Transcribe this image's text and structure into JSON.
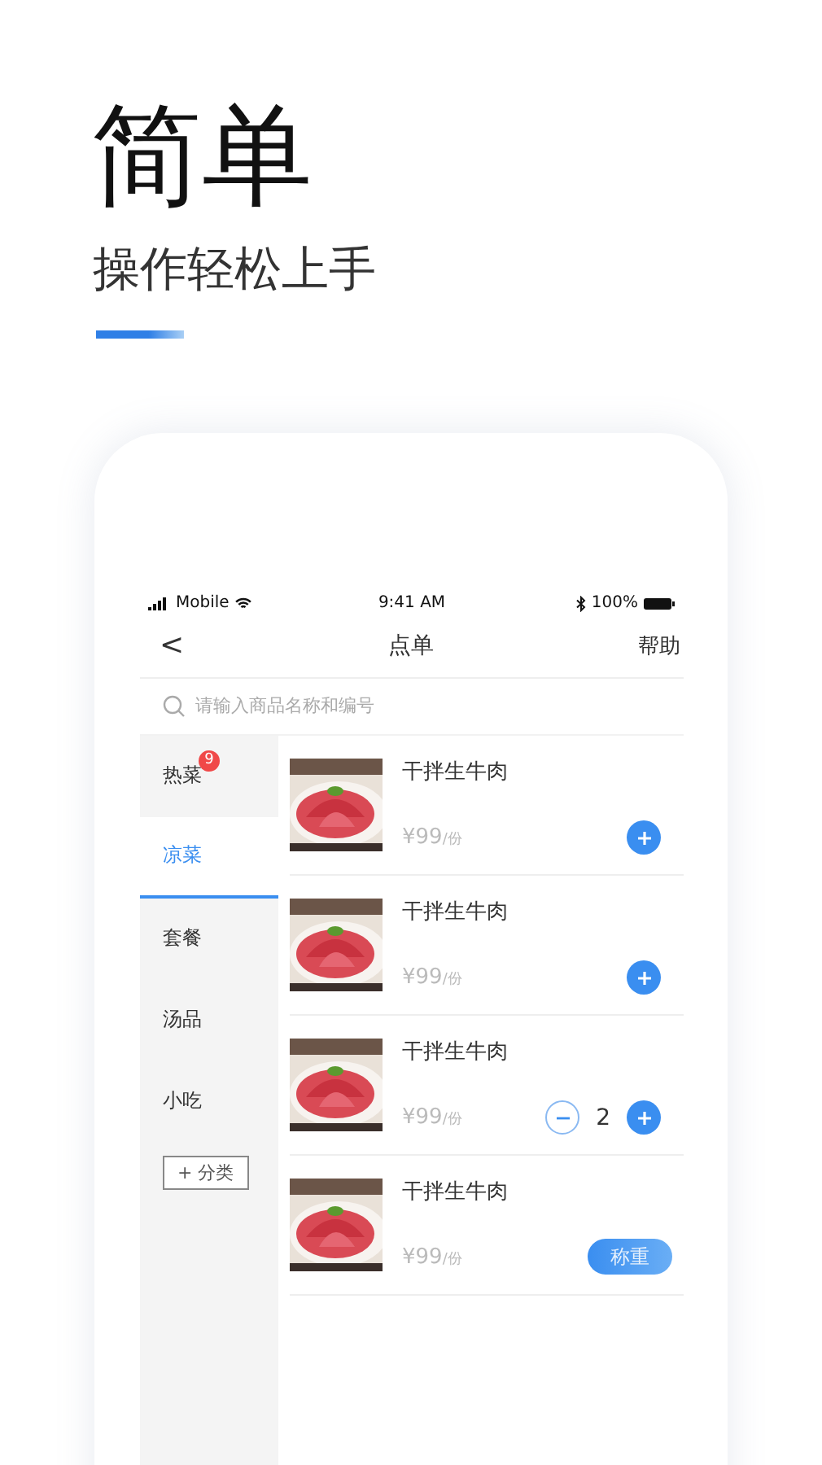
{
  "headline": "简单",
  "subtitle": "操作轻松上手",
  "status_bar": {
    "carrier": "Mobile",
    "time": "9:41 AM",
    "battery": "100%"
  },
  "nav": {
    "back": "<",
    "title": "点单",
    "action": "帮助"
  },
  "search": {
    "placeholder": "请输入商品名称和编号"
  },
  "categories": [
    {
      "label": "热菜",
      "selected": false,
      "badge": "9"
    },
    {
      "label": "凉菜",
      "selected": true
    },
    {
      "label": "套餐",
      "selected": false
    },
    {
      "label": "汤品",
      "selected": false
    },
    {
      "label": "小吃",
      "selected": false
    }
  ],
  "add_category": "+ 分类",
  "dishes": [
    {
      "kind": "add",
      "name": "干拌生牛肉",
      "price": "¥99",
      "unit": "/份"
    },
    {
      "kind": "add",
      "name": "干拌生牛肉",
      "price": "¥99",
      "unit": "/份"
    },
    {
      "kind": "stepper",
      "name": "干拌生牛肉",
      "price": "¥99",
      "unit": "/份",
      "count": "2"
    },
    {
      "kind": "weigh",
      "name": "干拌生牛肉",
      "price": "¥99",
      "unit": "/份",
      "button": "称重"
    }
  ]
}
